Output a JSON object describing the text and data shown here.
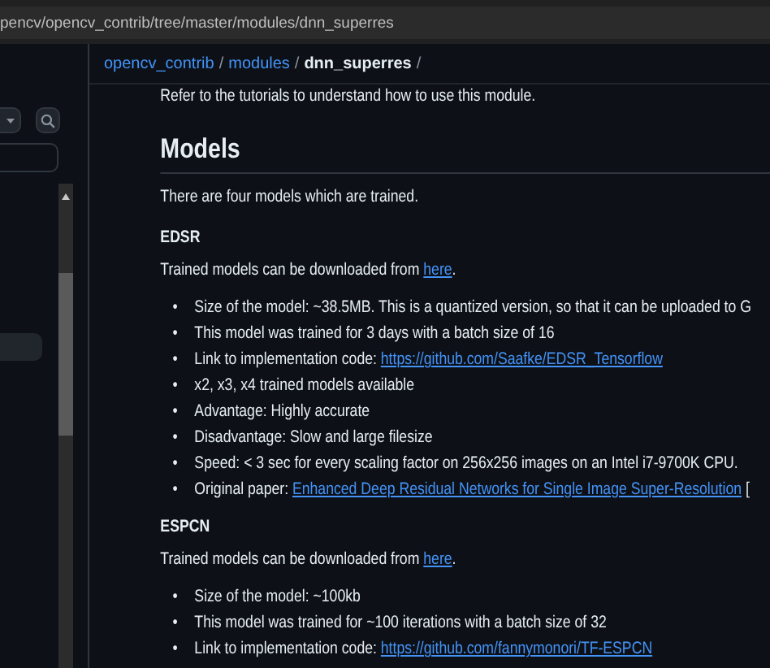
{
  "address_bar": {
    "url": "pencv/opencv_contrib/tree/master/modules/dnn_superres"
  },
  "breadcrumb": {
    "links": [
      "opencv_contrib",
      "modules"
    ],
    "current": "dnn_superres",
    "separator": "/"
  },
  "readme": [
    {
      "kind": "paragraph",
      "text": "Refer to the tutorials to understand how to use this module."
    },
    {
      "kind": "heading",
      "text": "Models"
    },
    {
      "kind": "paragraph",
      "text": "There are four models which are trained."
    },
    {
      "kind": "subheading",
      "text": "EDSR"
    },
    {
      "kind": "paragraph",
      "text": "Trained models can be downloaded from ",
      "link": "here",
      "after": "."
    },
    {
      "kind": "list",
      "marker": "•",
      "items": [
        {
          "text": "Size of the model: ~38.5MB. This is a quantized version, so that it can be uploaded to G"
        },
        {
          "text": "This model was trained for 3 days with a batch size of 16"
        },
        {
          "text": "Link to implementation code: ",
          "link": "https://github.com/Saafke/EDSR_Tensorflow"
        },
        {
          "text": "x2, x3, x4 trained models available"
        },
        {
          "text": "Advantage: Highly accurate"
        },
        {
          "text": "Disadvantage: Slow and large filesize"
        },
        {
          "text": "Speed: < 3 sec for every scaling factor on 256x256 images on an Intel i7-9700K CPU."
        },
        {
          "text": "Original paper: ",
          "link": "Enhanced Deep Residual Networks for Single Image Super-Resolution",
          "after": " ["
        }
      ]
    },
    {
      "kind": "subheading",
      "text": "ESPCN"
    },
    {
      "kind": "paragraph",
      "text": "Trained models can be downloaded from ",
      "link": "here",
      "after": "."
    },
    {
      "kind": "list",
      "marker": "•",
      "items": [
        {
          "text": "Size of the model: ~100kb"
        },
        {
          "text": "This model was trained for ~100 iterations with a batch size of 32"
        },
        {
          "text": "Link to implementation code: ",
          "link": "https://github.com/fannymonori/TF-ESPCN"
        }
      ]
    }
  ]
}
